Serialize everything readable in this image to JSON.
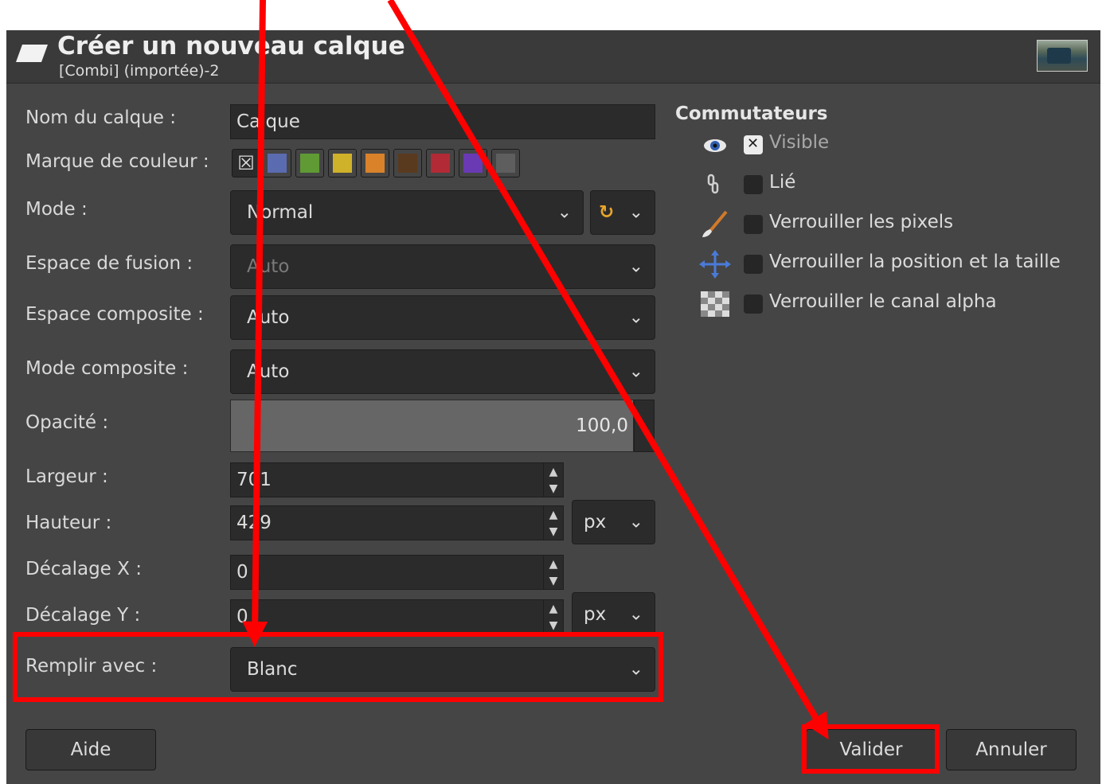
{
  "dialog": {
    "title": "Créer un nouveau calque",
    "subtitle": "[Combi] (importée)-2"
  },
  "form": {
    "layer_name": {
      "label": "Nom du calque :",
      "value": "Calque"
    },
    "color_tag": {
      "label": "Marque de couleur :",
      "none_glyph": "☒",
      "colors": [
        "#5b6bb0",
        "#5f9a35",
        "#d0b22a",
        "#d9822a",
        "#5a3a1e",
        "#b22a35",
        "#6a3ab5",
        "#5e5e5e"
      ]
    },
    "mode": {
      "label": "Mode :",
      "value": "Normal",
      "reset_icon": "↻"
    },
    "blend_space": {
      "label": "Espace de fusion :",
      "value": "Auto"
    },
    "composite_space": {
      "label": "Espace composite :",
      "value": "Auto"
    },
    "composite_mode": {
      "label": "Mode composite :",
      "value": "Auto"
    },
    "opacity": {
      "label": "Opacité :",
      "value": "100,0"
    },
    "width": {
      "label": "Largeur :",
      "value": "701"
    },
    "height": {
      "label": "Hauteur :",
      "value": "429",
      "unit": "px"
    },
    "offset_x": {
      "label": "Décalage X :",
      "value": "0"
    },
    "offset_y": {
      "label": "Décalage Y :",
      "value": "0",
      "unit": "px"
    },
    "fill": {
      "label": "Remplir avec :",
      "value": "Blanc"
    }
  },
  "switches": {
    "title": "Commutateurs",
    "items": [
      {
        "label": "Visible",
        "checked": true,
        "icon": "eye-icon"
      },
      {
        "label": "Lié",
        "checked": false,
        "icon": "chain-icon"
      },
      {
        "label": "Verrouiller les pixels",
        "checked": false,
        "icon": "paintbrush-icon"
      },
      {
        "label": "Verrouiller la position et la taille",
        "checked": false,
        "icon": "move-arrows-icon"
      },
      {
        "label": "Verrouiller le canal alpha",
        "checked": false,
        "icon": "checkerboard-icon"
      }
    ]
  },
  "buttons": {
    "help": "Aide",
    "ok": "Valider",
    "cancel": "Annuler"
  },
  "glyphs": {
    "chevron": "⌄",
    "spin_up": "▲",
    "spin_down": "▼"
  },
  "annotation_color": "#ff0000"
}
